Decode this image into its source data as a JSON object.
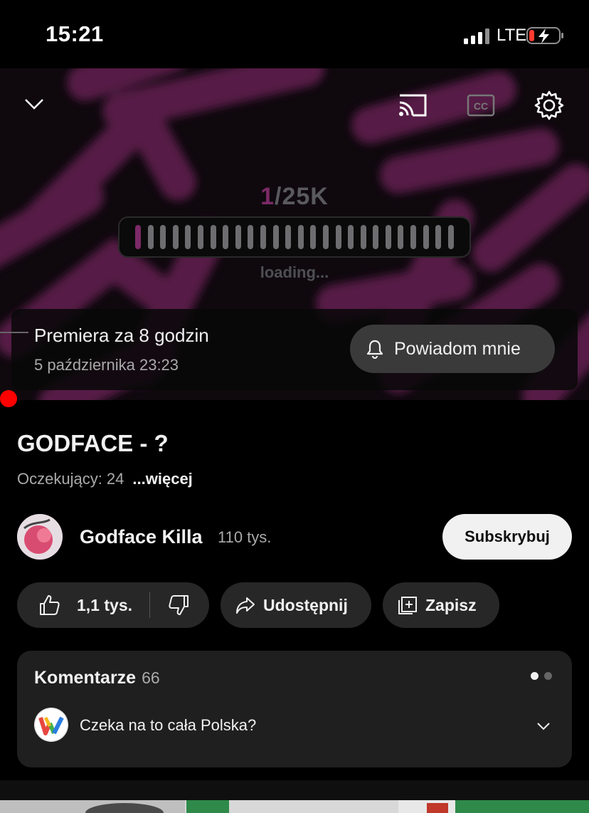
{
  "status_bar": {
    "time": "15:21",
    "network": "LTE"
  },
  "player": {
    "counter_first": "1",
    "counter_rest": "/25K",
    "loading_text": "loading...",
    "loading_progress_fraction": 0.04,
    "loading_segments": 26,
    "art_accent": "#5a1a48"
  },
  "premiere": {
    "title": "Premiera za 8 godzin",
    "date": "5 października 23:23",
    "notify_label": "Powiadom mnie"
  },
  "video": {
    "title": "GODFACE - ?",
    "waiting": "Oczekujący: 24",
    "more": "...więcej"
  },
  "channel": {
    "name": "Godface Killa",
    "subscribers": "110 tys.",
    "subscribe_label": "Subskrybuj"
  },
  "actions": {
    "likes": "1,1 tys.",
    "share": "Udostępnij",
    "save": "Zapisz"
  },
  "comments": {
    "label": "Komentarze",
    "count": "66",
    "top_comment": "Czeka na to cała Polska?"
  },
  "colors": {
    "accent_red": "#ff0000",
    "art_purple": "#7b2a67"
  }
}
